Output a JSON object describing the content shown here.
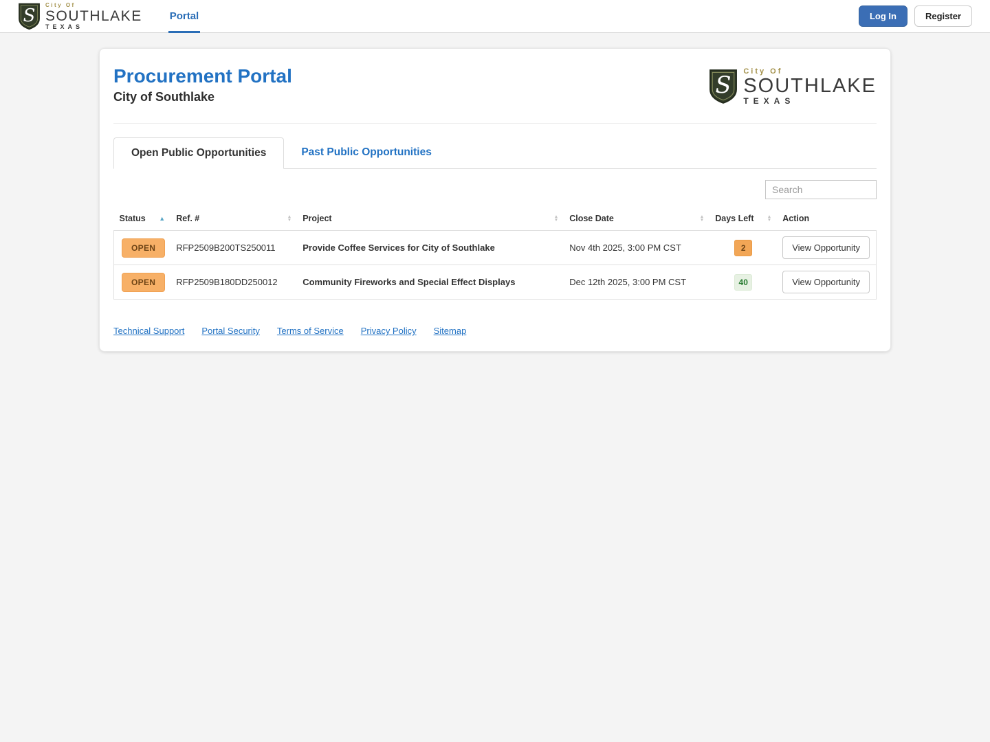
{
  "logo": {
    "monogram": "S",
    "city_of": "City Of",
    "name": "SOUTHLAKE",
    "state": "TEXAS"
  },
  "topbar": {
    "nav_portal_label": "Portal",
    "login_label": "Log In",
    "register_label": "Register"
  },
  "page": {
    "title": "Procurement Portal",
    "subtitle": "City of Southlake"
  },
  "tabs": {
    "open": "Open Public Opportunities",
    "past": "Past Public Opportunities"
  },
  "search": {
    "placeholder": "Search"
  },
  "table": {
    "columns": {
      "status": "Status",
      "ref": "Ref. #",
      "project": "Project",
      "close_date": "Close Date",
      "days_left": "Days Left",
      "action": "Action"
    },
    "rows": [
      {
        "status": "OPEN",
        "ref": "RFP2509B200TS250011",
        "project": "Provide Coffee Services for City of Southlake",
        "close_date": "Nov 4th 2025, 3:00 PM CST",
        "days_left": "2",
        "action_label": "View Opportunity"
      },
      {
        "status": "OPEN",
        "ref": "RFP2509B180DD250012",
        "project": "Community Fireworks and Special Effect Displays",
        "close_date": "Dec 12th 2025, 3:00 PM CST",
        "days_left": "40",
        "action_label": "View Opportunity"
      }
    ]
  },
  "footer": {
    "links": [
      "Technical Support",
      "Portal Security",
      "Terms of Service",
      "Privacy Policy",
      "Sitemap"
    ]
  },
  "colors": {
    "accent_blue": "#2272c3",
    "nav_blue": "#2a6db6",
    "login_button": "#3b6eb5",
    "open_badge_bg": "#f7b067",
    "days_warning_bg": "#f2a656",
    "days_success_bg": "#e7f1e3",
    "days_success_text": "#257a2e",
    "shield_green": "#333d2a",
    "logo_gold": "#a4924c"
  }
}
